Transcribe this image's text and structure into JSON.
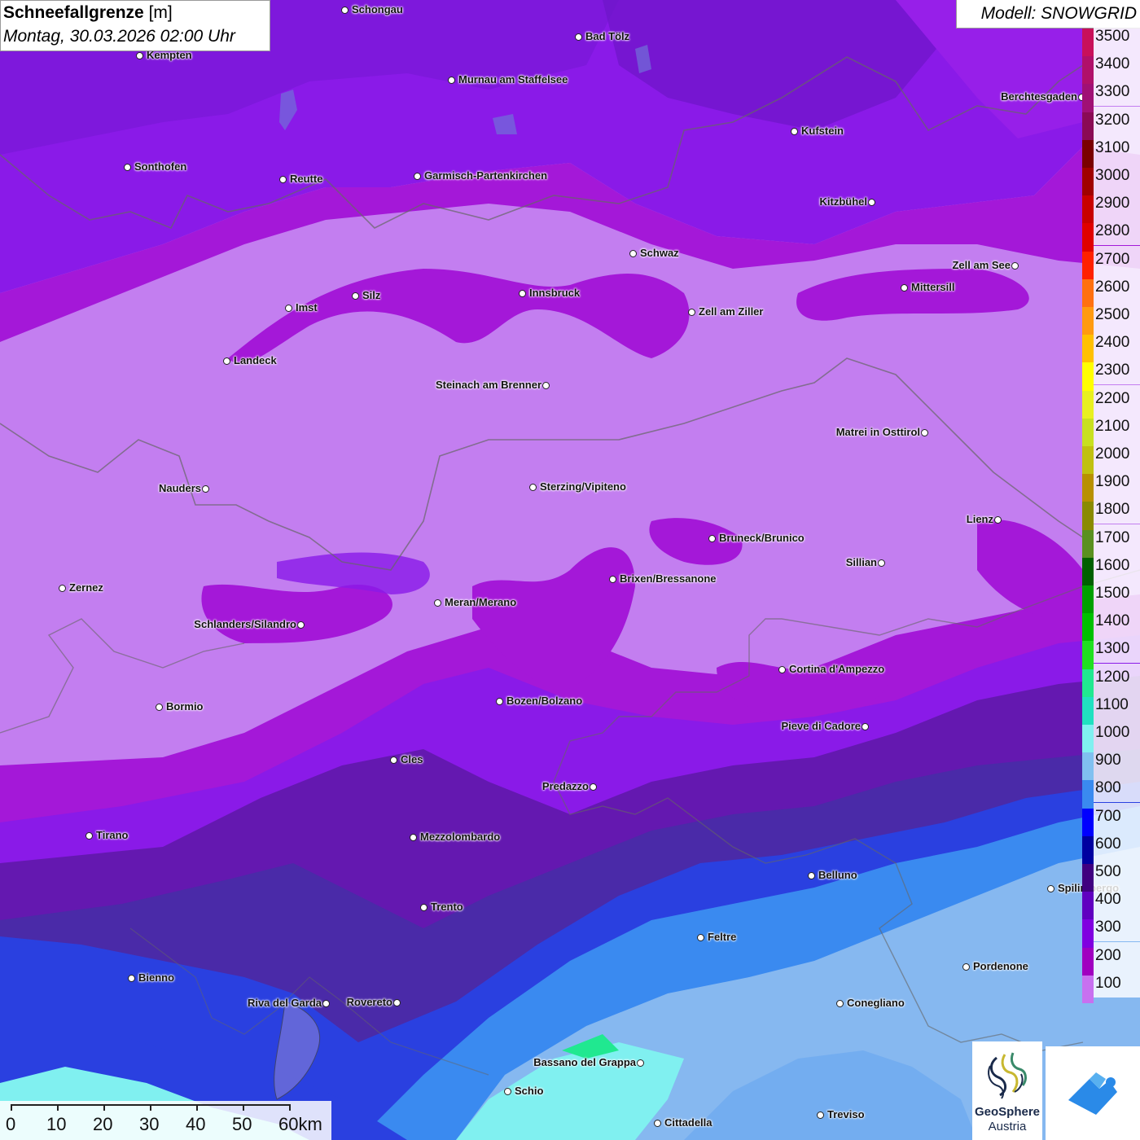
{
  "title": {
    "main": "Schneefallgrenze",
    "unit": "[m]",
    "date": "Montag, 30.03.2026 02:00 Uhr"
  },
  "model": "Modell: SNOWGRID",
  "legend": [
    {
      "label": "3500",
      "color": "#c8105a"
    },
    {
      "label": "3400",
      "color": "#b0106a"
    },
    {
      "label": "3300",
      "color": "#a01075"
    },
    {
      "label": "3200",
      "color": "#8a0a55"
    },
    {
      "label": "3100",
      "color": "#7a0000"
    },
    {
      "label": "3000",
      "color": "#a00000"
    },
    {
      "label": "2900",
      "color": "#c80000"
    },
    {
      "label": "2800",
      "color": "#e00000"
    },
    {
      "label": "2700",
      "color": "#ff2000"
    },
    {
      "label": "2600",
      "color": "#ff7010"
    },
    {
      "label": "2500",
      "color": "#ff9a10"
    },
    {
      "label": "2400",
      "color": "#ffc000"
    },
    {
      "label": "2300",
      "color": "#ffff00"
    },
    {
      "label": "2200",
      "color": "#e8f020"
    },
    {
      "label": "2100",
      "color": "#c8e020"
    },
    {
      "label": "2000",
      "color": "#c0c010"
    },
    {
      "label": "1900",
      "color": "#b89000"
    },
    {
      "label": "1800",
      "color": "#8a8a00"
    },
    {
      "label": "1700",
      "color": "#5a9020"
    },
    {
      "label": "1600",
      "color": "#006000"
    },
    {
      "label": "1500",
      "color": "#00a000"
    },
    {
      "label": "1400",
      "color": "#00c000"
    },
    {
      "label": "1300",
      "color": "#20e020"
    },
    {
      "label": "1200",
      "color": "#20e890"
    },
    {
      "label": "1100",
      "color": "#20e0c0"
    },
    {
      "label": "1000",
      "color": "#80f0f0"
    },
    {
      "label": "900",
      "color": "#80c0f0"
    },
    {
      "label": "800",
      "color": "#3a8af0"
    },
    {
      "label": "700",
      "color": "#0000ff"
    },
    {
      "label": "600",
      "color": "#0000a0"
    },
    {
      "label": "500",
      "color": "#400080"
    },
    {
      "label": "400",
      "color": "#6000c0"
    },
    {
      "label": "300",
      "color": "#8000e0"
    },
    {
      "label": "200",
      "color": "#a000c0"
    },
    {
      "label": "100",
      "color": "#c870f0"
    }
  ],
  "cities": [
    {
      "name": "Schongau",
      "side": "right"
    },
    {
      "name": "Bad Tölz",
      "side": "right"
    },
    {
      "name": "Kempten",
      "side": "right"
    },
    {
      "name": "Murnau am Staffelsee",
      "side": "right"
    },
    {
      "name": "Kufstein",
      "side": "right"
    },
    {
      "name": "Berchtesgaden",
      "side": "left"
    },
    {
      "name": "Sonthofen",
      "side": "right"
    },
    {
      "name": "Reutte",
      "side": "right"
    },
    {
      "name": "Garmisch-Partenkirchen",
      "side": "right"
    },
    {
      "name": "Kitzbühel",
      "side": "left"
    },
    {
      "name": "Schwaz",
      "side": "right"
    },
    {
      "name": "Zell am See",
      "side": "left"
    },
    {
      "name": "Innsbruck",
      "side": "right"
    },
    {
      "name": "Mittersill",
      "side": "right"
    },
    {
      "name": "Imst",
      "side": "right"
    },
    {
      "name": "Silz",
      "side": "right"
    },
    {
      "name": "Zell am Ziller",
      "side": "right"
    },
    {
      "name": "Landeck",
      "side": "right"
    },
    {
      "name": "Steinach am Brenner",
      "side": "left"
    },
    {
      "name": "Matrei in Osttirol",
      "side": "left"
    },
    {
      "name": "Nauders",
      "side": "left"
    },
    {
      "name": "Sterzing/Vipiteno",
      "side": "right"
    },
    {
      "name": "Lienz",
      "side": "left"
    },
    {
      "name": "Bruneck/Brunico",
      "side": "right"
    },
    {
      "name": "Sillian",
      "side": "left"
    },
    {
      "name": "Zernez",
      "side": "right"
    },
    {
      "name": "Brixen/Bressanone",
      "side": "right"
    },
    {
      "name": "Meran/Merano",
      "side": "right"
    },
    {
      "name": "Schlanders/Silandro",
      "side": "left"
    },
    {
      "name": "Cortina d'Ampezzo",
      "side": "right"
    },
    {
      "name": "Bozen/Bolzano",
      "side": "right"
    },
    {
      "name": "Bormio",
      "side": "right"
    },
    {
      "name": "Pieve di Cadore",
      "side": "left"
    },
    {
      "name": "Cles",
      "side": "right"
    },
    {
      "name": "Predazzo",
      "side": "left"
    },
    {
      "name": "Tirano",
      "side": "right"
    },
    {
      "name": "Mezzolombardo",
      "side": "right"
    },
    {
      "name": "Belluno",
      "side": "right"
    },
    {
      "name": "Spilimbergo",
      "side": "right"
    },
    {
      "name": "Trento",
      "side": "right"
    },
    {
      "name": "Feltre",
      "side": "right"
    },
    {
      "name": "Pordenone",
      "side": "right"
    },
    {
      "name": "Bienno",
      "side": "right"
    },
    {
      "name": "Riva del Garda",
      "side": "left"
    },
    {
      "name": "Rovereto",
      "side": "left"
    },
    {
      "name": "Conegliano",
      "side": "right"
    },
    {
      "name": "Bassano del Grappa",
      "side": "left"
    },
    {
      "name": "Schio",
      "side": "right"
    },
    {
      "name": "Treviso",
      "side": "right"
    },
    {
      "name": "Cittadella",
      "side": "right"
    }
  ],
  "scale": {
    "labels": [
      "0",
      "10",
      "20",
      "30",
      "40",
      "50",
      "60km"
    ]
  },
  "logo": {
    "line1": "GeoSphere",
    "line2": "Austria"
  },
  "colors": {
    "light_violet": "#c37ef0",
    "magenta": "#a418d8",
    "violet": "#8a1ae8",
    "deep_violet": "#6418b0",
    "dark": "#4a1a8a",
    "blue": "#2a40e0",
    "mid_blue": "#3a8af0",
    "light_blue": "#86b8f0",
    "cyan": "#80f0f0",
    "teal": "#20e890"
  }
}
